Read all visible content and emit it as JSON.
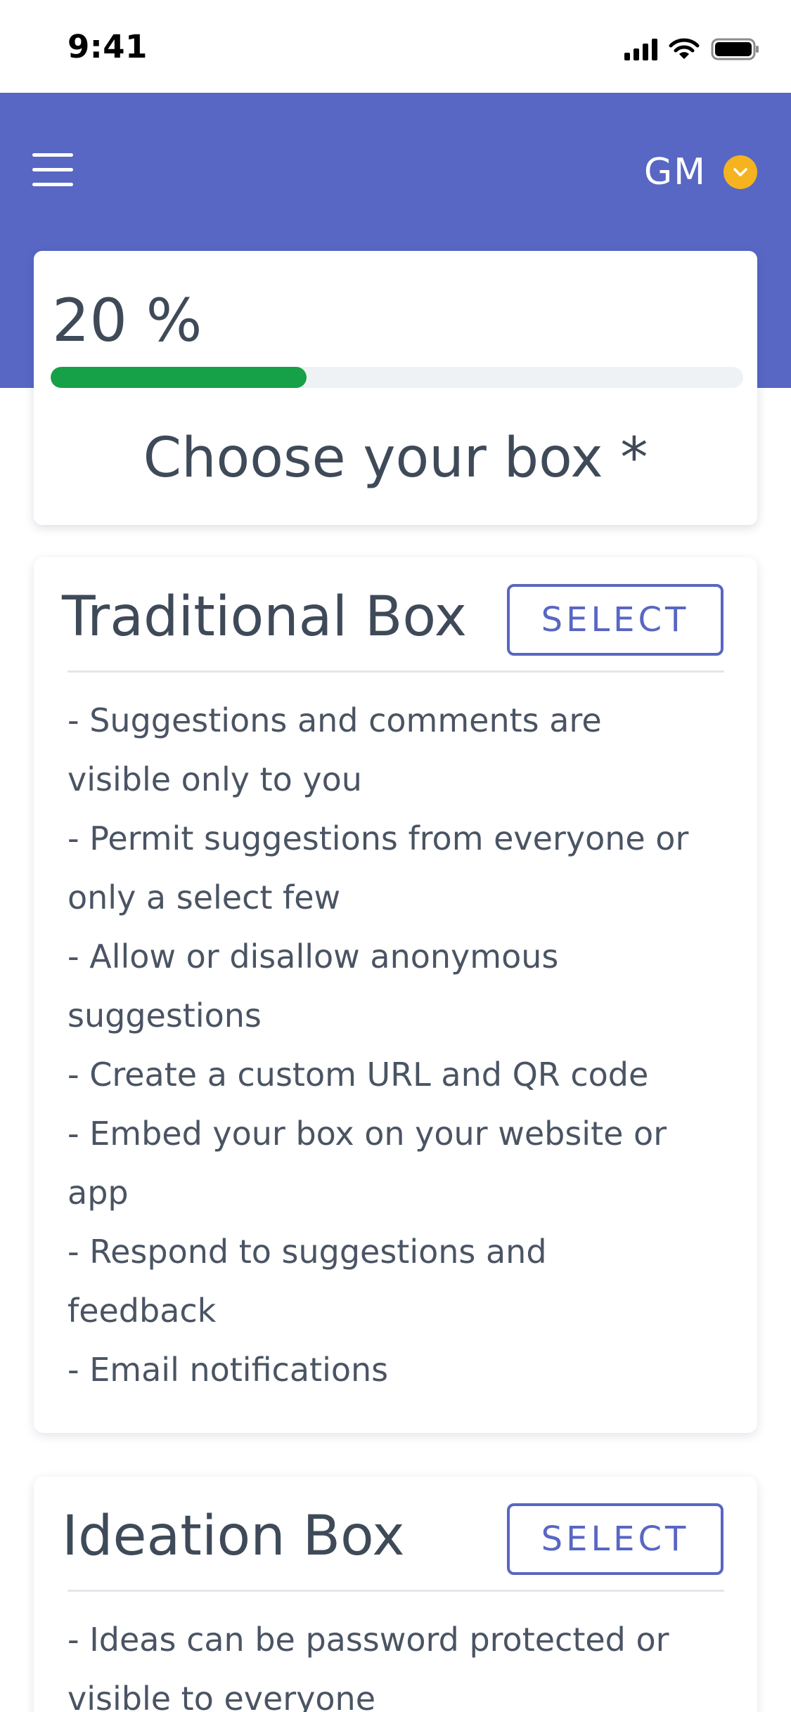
{
  "status_bar": {
    "time": "9:41",
    "icons": [
      "signal-icon",
      "wifi-icon",
      "battery-icon"
    ]
  },
  "header": {
    "menu_icon": "hamburger-menu-icon",
    "user_initials": "GM",
    "user_menu_icon": "chevron-down-icon"
  },
  "progress": {
    "text": "20 %",
    "value": 0.2,
    "title": "Choose your box *"
  },
  "boxes": [
    {
      "title": "Traditional Box",
      "select_label": "SELECT",
      "features": [
        "- Suggestions and comments are",
        "visible only to you",
        "- Permit suggestions from everyone or",
        "only a select few",
        "- Allow or disallow anonymous",
        "suggestions",
        "- Create a custom URL and QR code",
        "- Embed your box on your website or",
        "app",
        "- Respond to suggestions and",
        "feedback",
        "- Email notifications"
      ]
    },
    {
      "title": "Ideation Box",
      "select_label": "SELECT",
      "features": [
        "- Ideas can be password protected or",
        "visible to everyone"
      ]
    }
  ],
  "colors": {
    "header_blue": "#5867c3",
    "progress_green": "#16a047",
    "avatar_badge": "#f5b41f",
    "text_dark": "#3f4a59"
  }
}
